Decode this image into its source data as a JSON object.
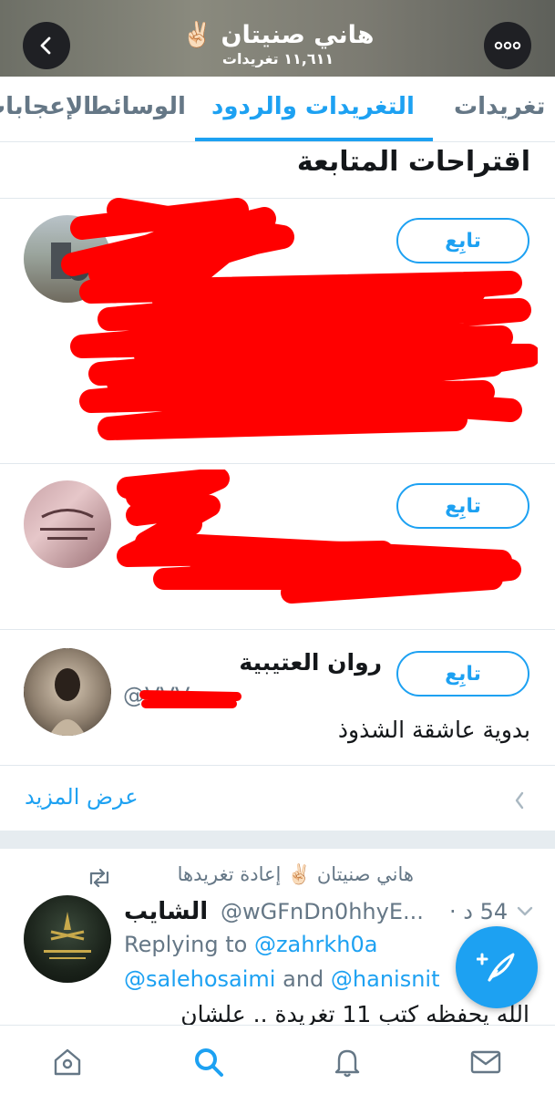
{
  "header": {
    "name": "هاني صنيتان ✌🏻",
    "tweet_count": "١١,٦١١ تغريدات"
  },
  "tabs": [
    {
      "label": "تغريدات"
    },
    {
      "label": "التغريدات والردود"
    },
    {
      "label": "الوسائط"
    },
    {
      "label": "الإعجابات"
    }
  ],
  "suggestions": {
    "title": "اقتراحات المتابعة",
    "follow_label": "تابِع",
    "items": [
      {
        "name": "",
        "handle": "",
        "bio": ""
      },
      {
        "name": "",
        "handle": "",
        "bio": ""
      },
      {
        "name": "روان العتيبية",
        "handle": "@VVV",
        "bio": "بدوية عاشقة الشذوذ"
      }
    ],
    "show_more": "عرض المزيد"
  },
  "tweet": {
    "retweeted_by": "هاني صنيتان ✌🏻 إعادة تغريدها",
    "name": "الشايب",
    "handle": "@wGFnDn0hhyE...",
    "time": "54 د ·",
    "replying_prefix": "Replying to",
    "replying_to_1": "@zahrkh0a",
    "replying_to_2": "@salehosaimi",
    "replying_and": "and",
    "replying_to_3": "@hanisnit",
    "body": "الله يحفظه كتب 11 تغريدة .. علشان"
  },
  "colors": {
    "accent": "#1da1f2",
    "muted": "#657786",
    "redaction": "#ff0000"
  },
  "icons": [
    "back-icon",
    "more-icon",
    "chevron-right-icon",
    "retweet-icon",
    "chevron-down-icon",
    "compose-icon",
    "home-icon",
    "search-icon",
    "notifications-icon",
    "messages-icon"
  ]
}
